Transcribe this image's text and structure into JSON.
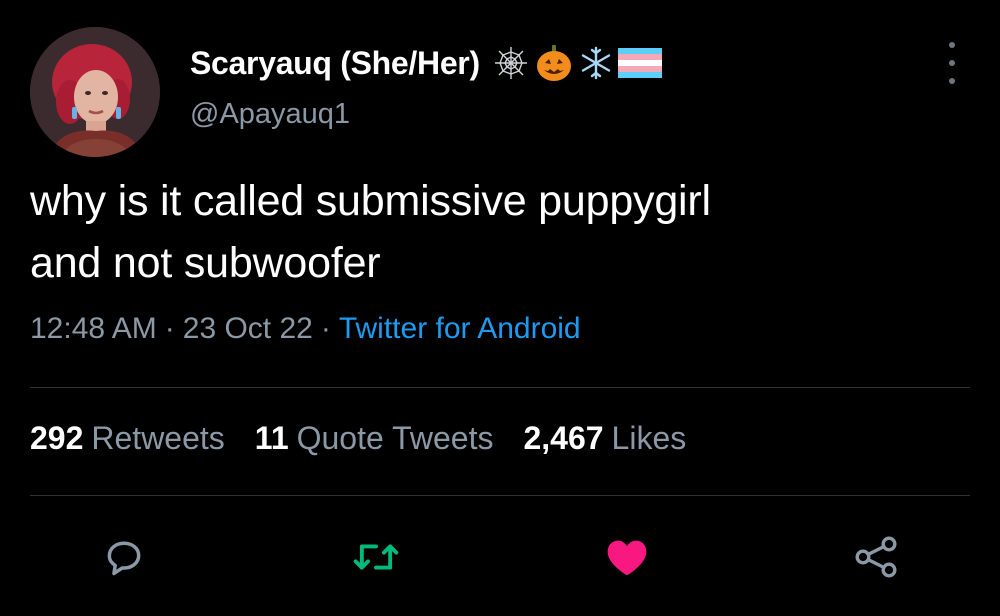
{
  "user": {
    "display_name": "Scaryauq (She/Her)",
    "handle": "@Apayauq1",
    "name_emojis": [
      "spider-web",
      "jack-o-lantern",
      "snowflake",
      "transgender-flag"
    ]
  },
  "tweet": {
    "text_line1": "why is it called submissive puppygirl",
    "text_line2": "and not subwoofer",
    "time": "12:48 AM",
    "separator": "·",
    "date": "23 Oct 22",
    "source": "Twitter for Android"
  },
  "stats": {
    "retweets_count": "292",
    "retweets_label": "Retweets",
    "quotes_count": "11",
    "quotes_label": "Quote Tweets",
    "likes_count": "2,467",
    "likes_label": "Likes"
  },
  "actions": [
    "reply-icon",
    "retweet-icon",
    "like-icon",
    "share-icon"
  ],
  "colors": {
    "background": "#000000",
    "text_primary": "#ffffff",
    "text_secondary": "#8b98a5",
    "link": "#1d9bf0",
    "retweet_green": "#00ba7c",
    "like_pink": "#f91880",
    "divider": "#2f3336"
  }
}
